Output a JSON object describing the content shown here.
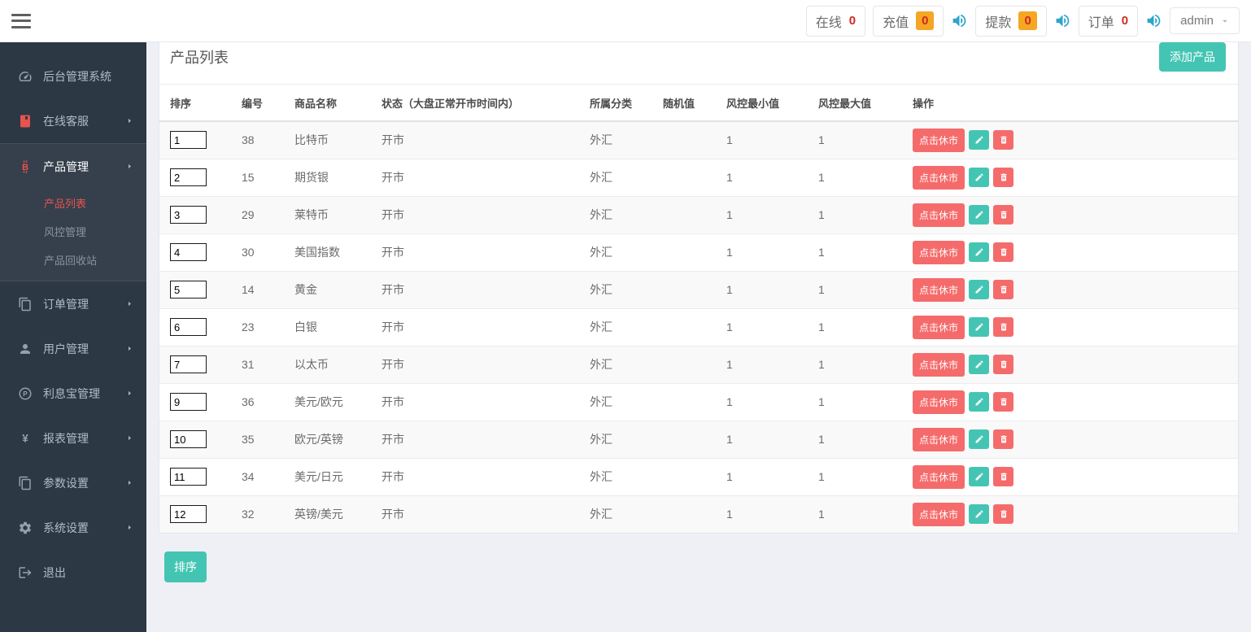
{
  "topbar": {
    "stats": [
      {
        "label": "在线",
        "count": "0",
        "badge": "plain"
      },
      {
        "label": "充值",
        "count": "0",
        "badge": "orange"
      },
      {
        "label": "提款",
        "count": "0",
        "badge": "orange"
      },
      {
        "label": "订单",
        "count": "0",
        "badge": "plain"
      }
    ],
    "user": {
      "name": "admin"
    }
  },
  "sidebar": {
    "items": [
      {
        "label": "后台管理系统",
        "icon": "dashboard-icon"
      },
      {
        "label": "在线客服",
        "icon": "book-icon"
      },
      {
        "label": "产品管理",
        "icon": "bitcoin-icon",
        "children": [
          {
            "label": "产品列表"
          },
          {
            "label": "风控管理"
          },
          {
            "label": "产品回收站"
          }
        ]
      },
      {
        "label": "订单管理",
        "icon": "files-icon"
      },
      {
        "label": "用户管理",
        "icon": "user-icon"
      },
      {
        "label": "利息宝管理",
        "icon": "circle-p-icon"
      },
      {
        "label": "报表管理",
        "icon": "yen-icon"
      },
      {
        "label": "参数设置",
        "icon": "files-icon"
      },
      {
        "label": "系统设置",
        "icon": "gear-icon"
      },
      {
        "label": "退出",
        "icon": "signout-icon"
      }
    ]
  },
  "panel": {
    "title": "产品列表",
    "add_button_label": "添加产品",
    "sort_button_label": "排序",
    "table": {
      "headers": [
        "排序",
        "编号",
        "商品名称",
        "状态（大盘正常开市时间内）",
        "所属分类",
        "随机值",
        "风控最小值",
        "风控最大值",
        "操作"
      ],
      "close_market_label": "点击休市",
      "rows": [
        {
          "sort": "1",
          "id": "38",
          "name": "比特币",
          "status": "开市",
          "category": "外汇",
          "random": "",
          "risk_min": "1",
          "risk_max": "1"
        },
        {
          "sort": "2",
          "id": "15",
          "name": "期货银",
          "status": "开市",
          "category": "外汇",
          "random": "",
          "risk_min": "1",
          "risk_max": "1"
        },
        {
          "sort": "3",
          "id": "29",
          "name": "莱特币",
          "status": "开市",
          "category": "外汇",
          "random": "",
          "risk_min": "1",
          "risk_max": "1"
        },
        {
          "sort": "4",
          "id": "30",
          "name": "美国指数",
          "status": "开市",
          "category": "外汇",
          "random": "",
          "risk_min": "1",
          "risk_max": "1"
        },
        {
          "sort": "5",
          "id": "14",
          "name": "黄金",
          "status": "开市",
          "category": "外汇",
          "random": "",
          "risk_min": "1",
          "risk_max": "1"
        },
        {
          "sort": "6",
          "id": "23",
          "name": "白银",
          "status": "开市",
          "category": "外汇",
          "random": "",
          "risk_min": "1",
          "risk_max": "1"
        },
        {
          "sort": "7",
          "id": "31",
          "name": "以太币",
          "status": "开市",
          "category": "外汇",
          "random": "",
          "risk_min": "1",
          "risk_max": "1"
        },
        {
          "sort": "9",
          "id": "36",
          "name": "美元/欧元",
          "status": "开市",
          "category": "外汇",
          "random": "",
          "risk_min": "1",
          "risk_max": "1"
        },
        {
          "sort": "10",
          "id": "35",
          "name": "欧元/英镑",
          "status": "开市",
          "category": "外汇",
          "random": "",
          "risk_min": "1",
          "risk_max": "1"
        },
        {
          "sort": "11",
          "id": "34",
          "name": "美元/日元",
          "status": "开市",
          "category": "外汇",
          "random": "",
          "risk_min": "1",
          "risk_max": "1"
        },
        {
          "sort": "12",
          "id": "32",
          "name": "英镑/美元",
          "status": "开市",
          "category": "外汇",
          "random": "",
          "risk_min": "1",
          "risk_max": "1"
        }
      ]
    }
  },
  "colors": {
    "accent_teal": "#44c5b3",
    "danger_red": "#f56b6b",
    "badge_orange": "#f5a623",
    "count_red": "#cc2a21",
    "speaker_blue": "#2ea3cc",
    "sidebar_bg": "#2c3844",
    "active_red": "#e8534e",
    "content_bg": "#eef0f5"
  }
}
